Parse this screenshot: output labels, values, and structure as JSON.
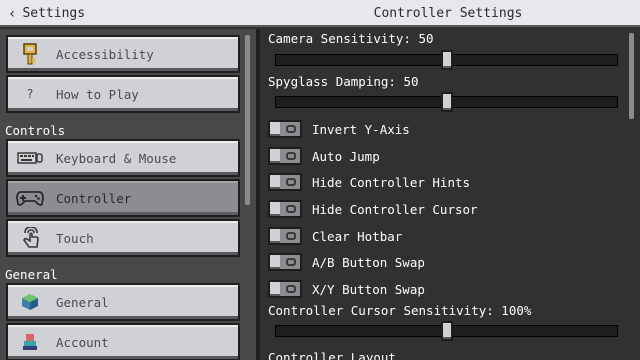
{
  "header": {
    "back_label": "Settings",
    "title": "Controller Settings"
  },
  "sidebar": {
    "items_top": [
      {
        "label": "Accessibility",
        "icon": "key-icon"
      },
      {
        "label": "How to Play",
        "icon": "question-icon",
        "icon_text": "?"
      }
    ],
    "section_controls": "Controls",
    "controls_items": [
      {
        "label": "Keyboard & Mouse",
        "icon": "keyboard-icon"
      },
      {
        "label": "Controller",
        "icon": "gamepad-icon",
        "selected": true
      },
      {
        "label": "Touch",
        "icon": "touch-icon"
      }
    ],
    "section_general": "General",
    "general_items": [
      {
        "label": "General",
        "icon": "cube-icon"
      },
      {
        "label": "Account",
        "icon": "account-icon"
      }
    ]
  },
  "settings": {
    "camera_sensitivity": {
      "label": "Camera Sensitivity: 50",
      "value_percent": 50
    },
    "spyglass_damping": {
      "label": "Spyglass Damping: 50",
      "value_percent": 50
    },
    "toggles": [
      {
        "label": "Invert Y-Axis",
        "on": false
      },
      {
        "label": "Auto Jump",
        "on": false
      },
      {
        "label": "Hide Controller Hints",
        "on": false
      },
      {
        "label": "Hide Controller Cursor",
        "on": false
      },
      {
        "label": "Clear Hotbar",
        "on": false
      },
      {
        "label": "A/B Button Swap",
        "on": false
      },
      {
        "label": "X/Y Button Swap",
        "on": false
      }
    ],
    "cursor_sensitivity": {
      "label": "Controller Cursor Sensitivity: 100%",
      "value_percent": 50
    },
    "layout_heading": "Controller Layout"
  },
  "colors": {
    "accent_green": "#3c8527",
    "button_face": "#d0d1d4",
    "button_selected": "#8c8d90",
    "panel_bg": "#313131",
    "sidebar_bg": "#48494a"
  }
}
